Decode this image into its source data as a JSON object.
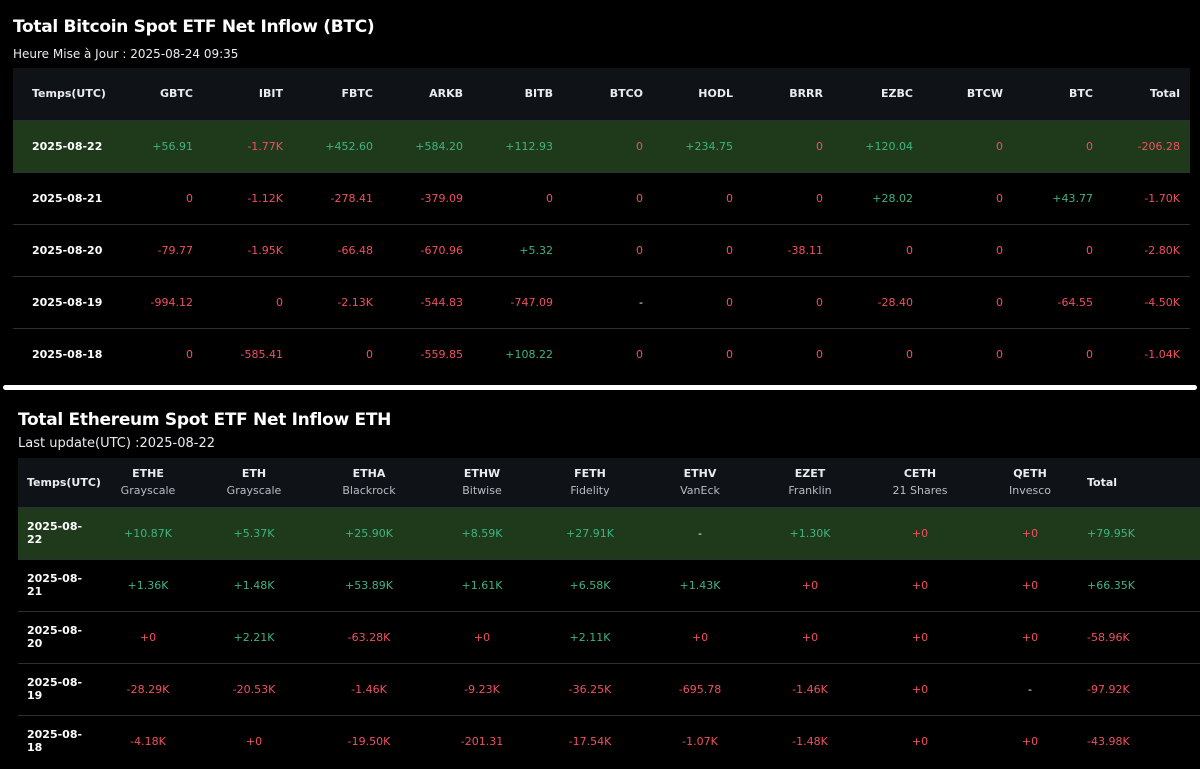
{
  "btc": {
    "title": "Total Bitcoin Spot ETF Net Inflow (BTC)",
    "subtitle": "Heure Mise à Jour : 2025-08-24 09:35",
    "headers": [
      "Temps(UTC)",
      "GBTC",
      "IBIT",
      "FBTC",
      "ARKB",
      "BITB",
      "BTCO",
      "HODL",
      "BRRR",
      "EZBC",
      "BTCW",
      "BTC",
      "Total"
    ],
    "rows": [
      [
        "2025-08-22",
        "+56.91",
        "-1.77K",
        "+452.60",
        "+584.20",
        "+112.93",
        "0",
        "+234.75",
        "0",
        "+120.04",
        "0",
        "0",
        "-206.28"
      ],
      [
        "2025-08-21",
        "0",
        "-1.12K",
        "-278.41",
        "-379.09",
        "0",
        "0",
        "0",
        "0",
        "+28.02",
        "0",
        "+43.77",
        "-1.70K"
      ],
      [
        "2025-08-20",
        "-79.77",
        "-1.95K",
        "-66.48",
        "-670.96",
        "+5.32",
        "0",
        "0",
        "-38.11",
        "0",
        "0",
        "0",
        "-2.80K"
      ],
      [
        "2025-08-19",
        "-994.12",
        "0",
        "-2.13K",
        "-544.83",
        "-747.09",
        "-",
        "0",
        "0",
        "-28.40",
        "0",
        "-64.55",
        "-4.50K"
      ],
      [
        "2025-08-18",
        "0",
        "-585.41",
        "0",
        "-559.85",
        "+108.22",
        "0",
        "0",
        "0",
        "0",
        "0",
        "0",
        "-1.04K"
      ]
    ]
  },
  "eth": {
    "title": "Total Ethereum Spot ETF Net Inflow ETH",
    "subtitle": "Last update(UTC) :2025-08-22",
    "headers": [
      {
        "ticker": "Temps(UTC)",
        "issuer": ""
      },
      {
        "ticker": "ETHE",
        "issuer": "Grayscale"
      },
      {
        "ticker": "ETH",
        "issuer": "Grayscale"
      },
      {
        "ticker": "ETHA",
        "issuer": "Blackrock"
      },
      {
        "ticker": "ETHW",
        "issuer": "Bitwise"
      },
      {
        "ticker": "FETH",
        "issuer": "Fidelity"
      },
      {
        "ticker": "ETHV",
        "issuer": "VanEck"
      },
      {
        "ticker": "EZET",
        "issuer": "Franklin"
      },
      {
        "ticker": "CETH",
        "issuer": "21 Shares"
      },
      {
        "ticker": "QETH",
        "issuer": "Invesco"
      },
      {
        "ticker": "Total",
        "issuer": ""
      }
    ],
    "rows": [
      [
        "2025-08-22",
        "+10.87K",
        "+5.37K",
        "+25.90K",
        "+8.59K",
        "+27.91K",
        "-",
        "+1.30K",
        "+0",
        "+0",
        "+79.95K"
      ],
      [
        "2025-08-21",
        "+1.36K",
        "+1.48K",
        "+53.89K",
        "+1.61K",
        "+6.58K",
        "+1.43K",
        "+0",
        "+0",
        "+0",
        "+66.35K"
      ],
      [
        "2025-08-20",
        "+0",
        "+2.21K",
        "-63.28K",
        "+0",
        "+2.11K",
        "+0",
        "+0",
        "+0",
        "+0",
        "-58.96K"
      ],
      [
        "2025-08-19",
        "-28.29K",
        "-20.53K",
        "-1.46K",
        "-9.23K",
        "-36.25K",
        "-695.78",
        "-1.46K",
        "+0",
        "-",
        "-97.92K"
      ],
      [
        "2025-08-18",
        "-4.18K",
        "+0",
        "-19.50K",
        "-201.31",
        "-17.54K",
        "-1.07K",
        "-1.48K",
        "+0",
        "+0",
        "-43.98K"
      ]
    ]
  },
  "colors": {
    "positive": "#3fb382",
    "negative": "#f0505f",
    "highlight_row": "#1e3a1b",
    "header_bg": "#0f1216"
  }
}
